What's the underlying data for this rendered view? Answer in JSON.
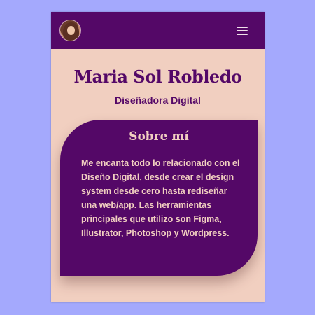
{
  "navbar": {
    "avatar_icon": "profile-photo",
    "menu_icon": "hamburger-menu-icon"
  },
  "profile": {
    "name": "Maria Sol Robledo",
    "role": "Diseñadora Digital"
  },
  "about": {
    "title": "Sobre mí",
    "text": "Me encanta todo lo relacionado con el Diseño Digital, desde crear el design system desde cero hasta rediseñar una web/app. Las herramientas principales que utilizo son Figma, Illustrator, Photoshop y Wordpress."
  },
  "colors": {
    "page_background": "#a4a9fd",
    "primary": "#540867",
    "surface": "#f1cfc0"
  }
}
